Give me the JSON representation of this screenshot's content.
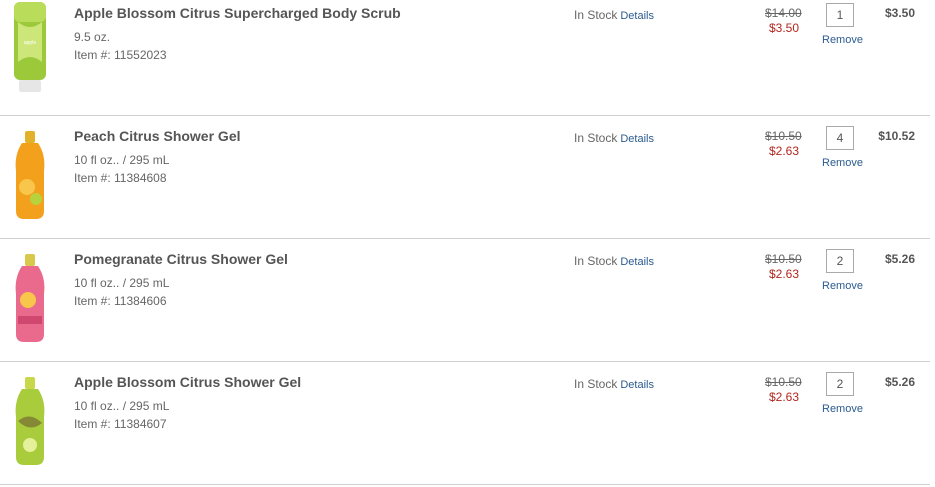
{
  "cart": {
    "items": [
      {
        "name": "Apple Blossom Citrus Supercharged Body Scrub",
        "size": "9.5 oz.",
        "item_number": "Item #: 11552023",
        "stock": "In Stock",
        "details_label": "Details",
        "original_price": "$14.00",
        "sale_price": "$3.50",
        "quantity": "1",
        "remove_label": "Remove",
        "total": "$3.50",
        "image_icon": "body-scrub-tube-icon",
        "image_color": "#9cc93a"
      },
      {
        "name": "Peach Citrus Shower Gel",
        "size": "10 fl oz.. / 295 mL",
        "item_number": "Item #: 11384608",
        "stock": "In Stock",
        "details_label": "Details",
        "original_price": "$10.50",
        "sale_price": "$2.63",
        "quantity": "4",
        "remove_label": "Remove",
        "total": "$10.52",
        "image_icon": "shower-gel-bottle-icon",
        "image_color": "#f3a11c"
      },
      {
        "name": "Pomegranate Citrus Shower Gel",
        "size": "10 fl oz.. / 295 mL",
        "item_number": "Item #: 11384606",
        "stock": "In Stock",
        "details_label": "Details",
        "original_price": "$10.50",
        "sale_price": "$2.63",
        "quantity": "2",
        "remove_label": "Remove",
        "total": "$5.26",
        "image_icon": "shower-gel-bottle-icon",
        "image_color": "#e96a8c"
      },
      {
        "name": "Apple Blossom Citrus Shower Gel",
        "size": "10 fl oz.. / 295 mL",
        "item_number": "Item #: 11384607",
        "stock": "In Stock",
        "details_label": "Details",
        "original_price": "$10.50",
        "sale_price": "$2.63",
        "quantity": "2",
        "remove_label": "Remove",
        "total": "$5.26",
        "image_icon": "shower-gel-bottle-icon",
        "image_color": "#a8cc3c"
      }
    ]
  },
  "colors": {
    "link": "#2a5b8f",
    "sale_price": "#b3261e",
    "divider": "#cfcfcf"
  }
}
